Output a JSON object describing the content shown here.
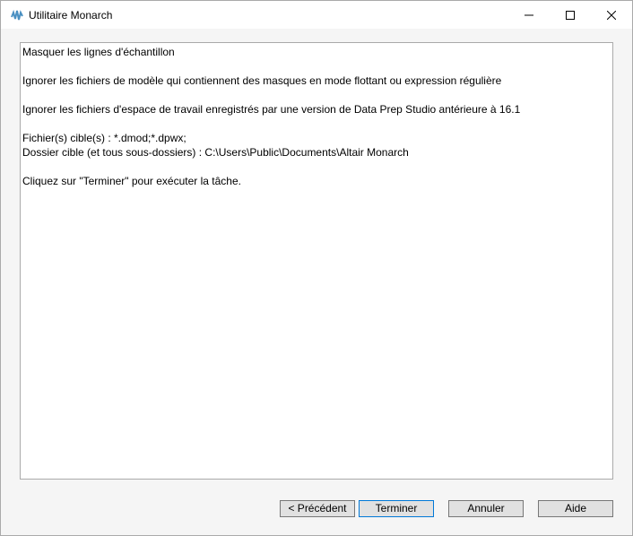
{
  "window": {
    "title": "Utilitaire Monarch",
    "icon": "monarch-app-icon"
  },
  "summary": {
    "lines": [
      "Masquer les lignes d'échantillon",
      "",
      "Ignorer les fichiers de modèle qui contiennent des masques en mode flottant ou expression régulière",
      "",
      "Ignorer les fichiers d'espace de travail enregistrés par une version de Data Prep Studio antérieure à 16.1",
      "",
      "Fichier(s) cible(s) : *.dmod;*.dpwx;",
      "Dossier cible (et tous sous-dossiers) : C:\\Users\\Public\\Documents\\Altair Monarch",
      "",
      "Cliquez sur \"Terminer\" pour exécuter la tâche."
    ]
  },
  "buttons": {
    "previous": "< Précédent",
    "finish": "Terminer",
    "cancel": "Annuler",
    "help": "Aide"
  },
  "colors": {
    "focus_border": "#0078d7",
    "icon": "#3c8dbc"
  }
}
